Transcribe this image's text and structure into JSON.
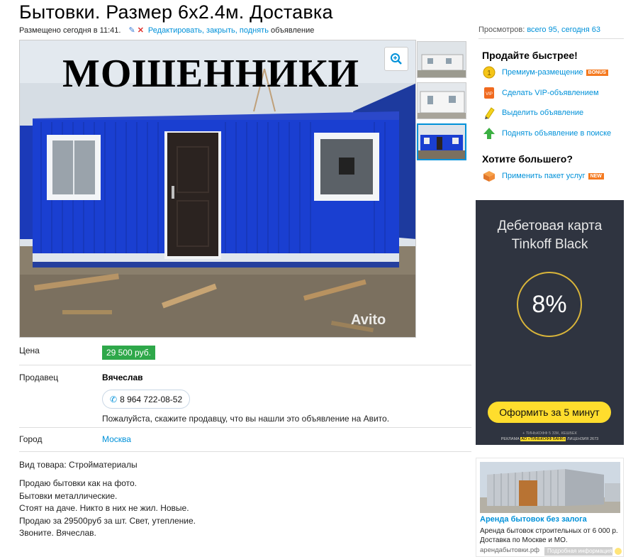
{
  "listing": {
    "title": "Бытовки. Размер 6х2.4м. Доставка",
    "posted": "Размещено сегодня в 11:41.",
    "edit_link": "Редактировать, закрыть, поднять",
    "edit_suffix": " объявление",
    "views_label": "Просмотров:",
    "views_value": "всего 95, сегодня 63",
    "photo_overlay": "МОШЕННИКИ",
    "watermark": "Avito"
  },
  "details": {
    "price_label": "Цена",
    "price": "29 500 руб.",
    "seller_label": "Продавец",
    "seller_name": "Вячеслав",
    "phone": "8 964 722-08-52",
    "seller_note": "Пожалуйста, скажите продавцу, что вы нашли это объявление на Авито.",
    "city_label": "Город",
    "city": "Москва",
    "goods_type": "Вид товара: Стройматериалы",
    "description": [
      "Продаю бытовки как на фото.",
      "Бытовки металлические.",
      "Стоят на даче. Никто в них не жил. Новые.",
      "Продаю за 29500руб за шт. Свет, утепление.",
      "Звоните. Вячеслав."
    ]
  },
  "sidebar": {
    "sell_faster": "Продайте быстрее!",
    "options": [
      {
        "label": "Премиум-размещение",
        "badge": "BONUS",
        "icon": "premium-coin-icon"
      },
      {
        "label": "Сделать VIP-объявлением",
        "badge": "",
        "icon": "vip-icon"
      },
      {
        "label": "Выделить объявление",
        "badge": "",
        "icon": "highlight-marker-icon"
      },
      {
        "label": "Поднять объявление в поиске",
        "badge": "",
        "icon": "raise-arrow-icon"
      }
    ],
    "want_more": "Хотите большего?",
    "package": {
      "label": "Применить пакет услуг",
      "badge": "NEW",
      "icon": "package-box-icon"
    }
  },
  "ad_tinkoff": {
    "title_line1": "Дебетовая карта",
    "title_line2": "Tinkoff Black",
    "percent": "8%",
    "button": "Оформить за 5 минут",
    "fine1": "+ ТИНЬКОФФ 5 ЗЗК, КЕШБЕК",
    "fine2_prefix": "РЕКЛАМА",
    "fine2_bank": "АО «ТИНЬКОФФ БАНК»",
    "fine2_suffix": "ЛИЦЕНЗИЯ 2673"
  },
  "ad_rent": {
    "title": "Аренда бытовок без залога",
    "text_line1": "Аренда бытовок строительных от 6 000 р.",
    "text_line2": "Доставка по Москве и МО.",
    "url": "арендабытовки.рф",
    "info": "Подробная информация"
  },
  "colors": {
    "link": "#0091d9",
    "price_bg": "#2ea84a",
    "tinkoff_bg": "#2f3440",
    "tinkoff_yellow": "#ffdd2d",
    "cabin_blue": "#1a3fd1"
  }
}
